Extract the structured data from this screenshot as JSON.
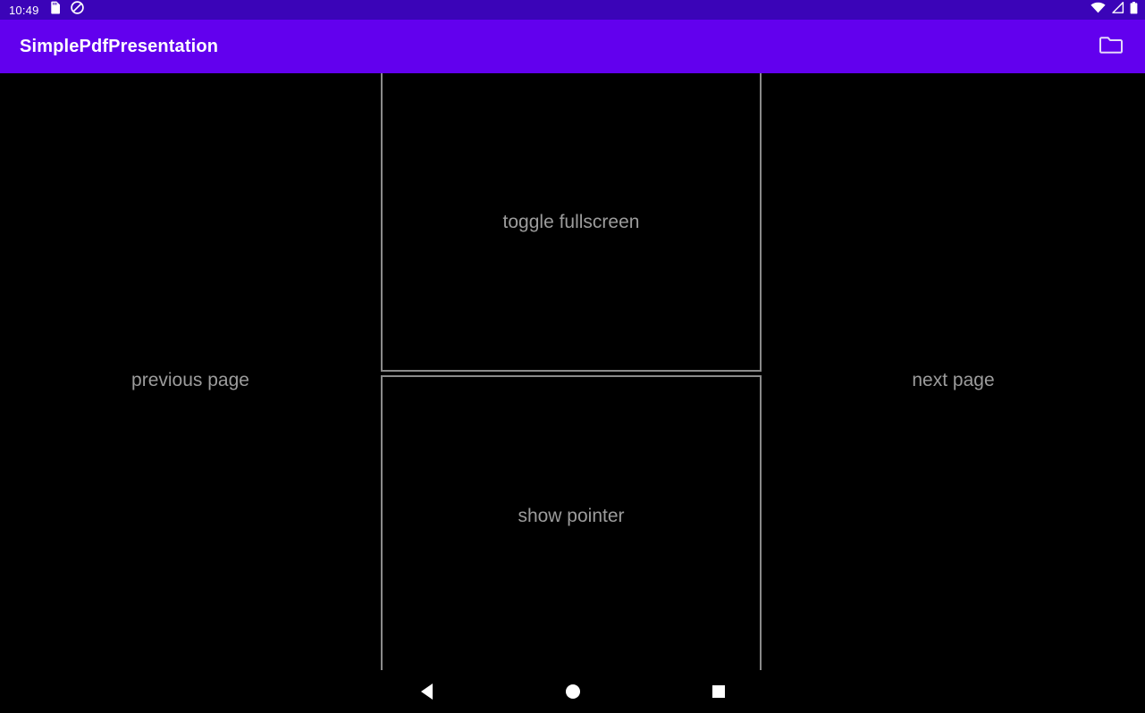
{
  "status_bar": {
    "clock": "10:49",
    "left_icons": [
      {
        "name": "sd-card-icon"
      },
      {
        "name": "do-not-disturb-icon"
      }
    ],
    "right_icons": [
      {
        "name": "wifi-icon"
      },
      {
        "name": "cellular-signal-icon"
      },
      {
        "name": "battery-icon"
      }
    ],
    "background_color": "#3B04B8"
  },
  "app_bar": {
    "title": "SimplePdfPresentation",
    "action_icon": "folder-icon",
    "background_color": "#6200EE",
    "title_color": "#FFFFFF"
  },
  "content": {
    "zones": {
      "previous_page": "previous page",
      "next_page": "next page",
      "toggle_fullscreen": "toggle fullscreen",
      "show_pointer": "show pointer"
    },
    "label_color": "#9C9C9C",
    "divider_color": "#8A8A8A",
    "background_color": "#000000"
  },
  "navigation_bar": {
    "buttons": [
      {
        "name": "back-button",
        "icon": "triangle-left-icon"
      },
      {
        "name": "home-button",
        "icon": "circle-icon"
      },
      {
        "name": "recents-button",
        "icon": "square-icon"
      }
    ],
    "background_color": "#000000"
  }
}
